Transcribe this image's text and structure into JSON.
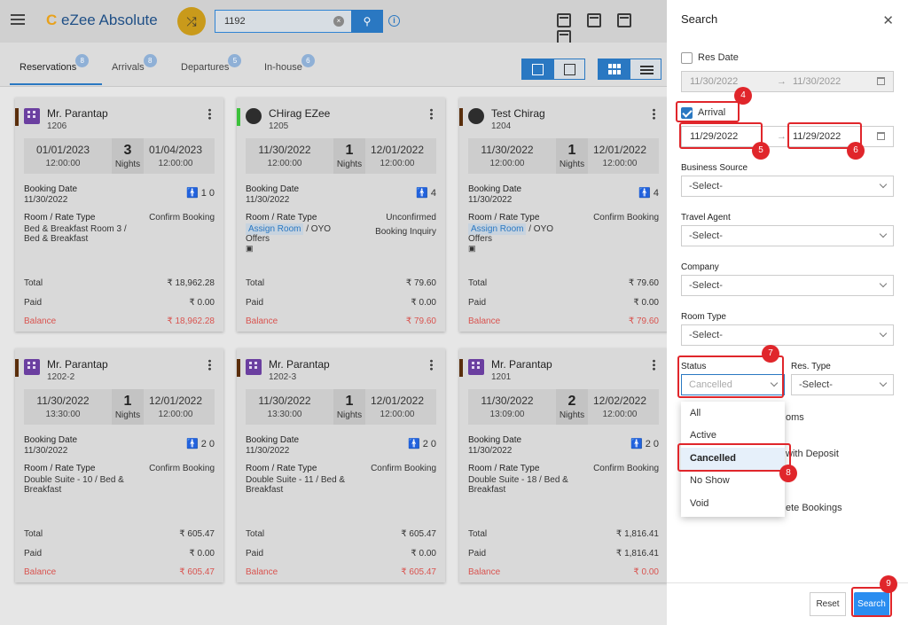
{
  "app": {
    "logo_mark": "C",
    "logo_text": "eZee Absolute",
    "search_value": "1192",
    "info_icon_label": "i"
  },
  "tabs": [
    {
      "label": "Reservations",
      "count": "8"
    },
    {
      "label": "Arrivals",
      "count": "8"
    },
    {
      "label": "Departures",
      "count": "5"
    },
    {
      "label": "In-house",
      "count": "6"
    }
  ],
  "cards": [
    {
      "name": "Mr. Parantap",
      "no": "1206",
      "arrive": "01/01/2023",
      "arrive_time": "12:00:00",
      "nights": "3",
      "depart": "01/04/2023",
      "depart_time": "12:00:00",
      "booking_date": "11/30/2022",
      "pax": "1  0",
      "status1": "Confirm Booking",
      "status2": "",
      "room": "Bed & Breakfast Room 3 / Bed & Breakfast",
      "total": "₹ 18,962.28",
      "paid": "₹ 0.00",
      "balance": "₹ 18,962.28"
    },
    {
      "name": "CHirag EZee",
      "no": "1205",
      "arrive": "11/30/2022",
      "arrive_time": "12:00:00",
      "nights": "1",
      "depart": "12/01/2022",
      "depart_time": "12:00:00",
      "booking_date": "11/30/2022",
      "pax": "4",
      "status1": "Unconfirmed",
      "status2": "Booking Inquiry",
      "room_assign": "Assign Room",
      "room_suffix": "/ OYO Offers",
      "total": "₹ 79.60",
      "paid": "₹ 0.00",
      "balance": "₹ 79.60"
    },
    {
      "name": "Test Chirag",
      "no": "1204",
      "arrive": "11/30/2022",
      "arrive_time": "12:00:00",
      "nights": "1",
      "depart": "12/01/2022",
      "depart_time": "12:00:00",
      "booking_date": "11/30/2022",
      "pax": "4",
      "status1": "Confirm Booking",
      "status2": "",
      "room_assign": "Assign Room",
      "room_suffix": "/ OYO Offers",
      "total": "₹ 79.60",
      "paid": "₹ 0.00",
      "balance": "₹ 79.60"
    },
    {
      "name": "Mr. Parantap",
      "no": "1202-2",
      "arrive": "11/30/2022",
      "arrive_time": "13:30:00",
      "nights": "1",
      "depart": "12/01/2022",
      "depart_time": "12:00:00",
      "booking_date": "11/30/2022",
      "pax": "2  0",
      "status1": "Confirm Booking",
      "status2": "",
      "room": "Double Suite - 10 / Bed & Breakfast",
      "total": "₹ 605.47",
      "paid": "₹ 0.00",
      "balance": "₹ 605.47"
    },
    {
      "name": "Mr. Parantap",
      "no": "1202-3",
      "arrive": "11/30/2022",
      "arrive_time": "13:30:00",
      "nights": "1",
      "depart": "12/01/2022",
      "depart_time": "12:00:00",
      "booking_date": "11/30/2022",
      "pax": "2  0",
      "status1": "Confirm Booking",
      "status2": "",
      "room": "Double Suite - 11 / Bed & Breakfast",
      "total": "₹ 605.47",
      "paid": "₹ 0.00",
      "balance": "₹ 605.47"
    },
    {
      "name": "Mr. Parantap",
      "no": "1201",
      "arrive": "11/30/2022",
      "arrive_time": "13:09:00",
      "nights": "2",
      "depart": "12/02/2022",
      "depart_time": "12:00:00",
      "booking_date": "11/30/2022",
      "pax": "2  0",
      "status1": "Confirm Booking",
      "status2": "",
      "room": "Double Suite - 18 / Bed & Breakfast",
      "total": "₹ 1,816.41",
      "paid": "₹ 1,816.41",
      "balance": "₹ 0.00"
    }
  ],
  "card_labels": {
    "booking_date": "Booking Date",
    "room_rate": "Room / Rate Type",
    "total": "Total",
    "paid": "Paid",
    "balance": "Balance",
    "nights": "Nights"
  },
  "panel": {
    "title": "Search",
    "res_date_label": "Res Date",
    "res_from": "11/30/2022",
    "res_to": "11/30/2022",
    "arrival_label": "Arrival",
    "arrival_from": "11/29/2022",
    "arrival_to": "11/29/2022",
    "business_source_label": "Business Source",
    "business_source_value": "-Select-",
    "travel_agent_label": "Travel Agent",
    "travel_agent_value": "-Select-",
    "company_label": "Company",
    "company_value": "-Select-",
    "room_type_label": "Room Type",
    "room_type_value": "-Select-",
    "status_label": "Status",
    "status_value": "Cancelled",
    "res_type_label": "Res. Type",
    "res_type_value": "-Select-",
    "status_options": [
      "All",
      "Active",
      "Cancelled",
      "No Show",
      "Void"
    ],
    "partial_rooms": "oms",
    "partial_deposit": "with Deposit",
    "partial_bookings": "ete Bookings",
    "reset_label": "Reset",
    "search_label": "Search"
  },
  "annotations": [
    "4",
    "5",
    "6",
    "7",
    "8",
    "9"
  ],
  "colors": {
    "accent": "#2a78c2",
    "annotation": "#e0262b",
    "balance": "#d9534f",
    "stripe_brown": "#5a2e0c",
    "stripe_green": "#3cc13b"
  }
}
